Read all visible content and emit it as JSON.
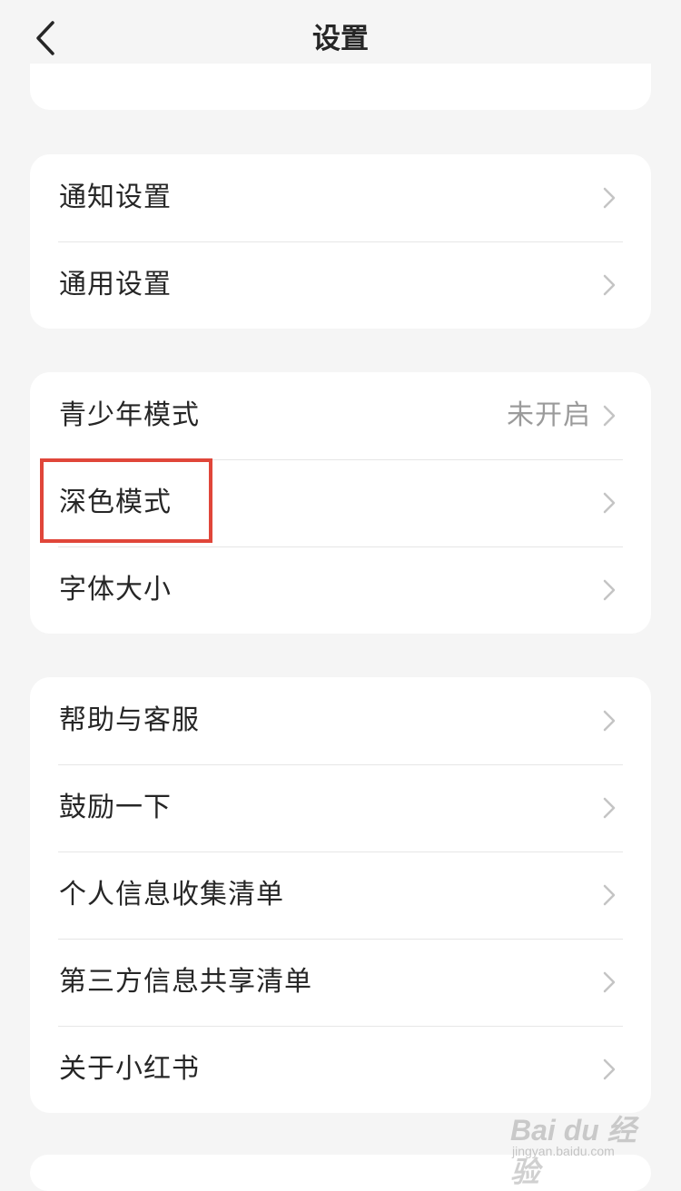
{
  "header": {
    "title": "设置",
    "back_icon": "chevron-left-icon"
  },
  "groups": [
    {
      "items": [
        {
          "label": "通知设置",
          "value": ""
        },
        {
          "label": "通用设置",
          "value": ""
        }
      ]
    },
    {
      "items": [
        {
          "label": "青少年模式",
          "value": "未开启"
        },
        {
          "label": "深色模式",
          "value": ""
        },
        {
          "label": "字体大小",
          "value": ""
        }
      ]
    },
    {
      "items": [
        {
          "label": "帮助与客服",
          "value": ""
        },
        {
          "label": "鼓励一下",
          "value": ""
        },
        {
          "label": "个人信息收集清单",
          "value": ""
        },
        {
          "label": "第三方信息共享清单",
          "value": ""
        },
        {
          "label": "关于小红书",
          "value": ""
        }
      ]
    }
  ],
  "highlight": {
    "target": "深色模式",
    "color": "#e0463a"
  },
  "watermark": {
    "logo": "Bai du 经验",
    "url": "jingyan.baidu.com"
  },
  "colors": {
    "background": "#f5f5f5",
    "card": "#ffffff",
    "text": "#262626",
    "secondary_text": "#9b9b9b",
    "chevron": "#c4c4c4",
    "divider": "#e6e6e6"
  }
}
